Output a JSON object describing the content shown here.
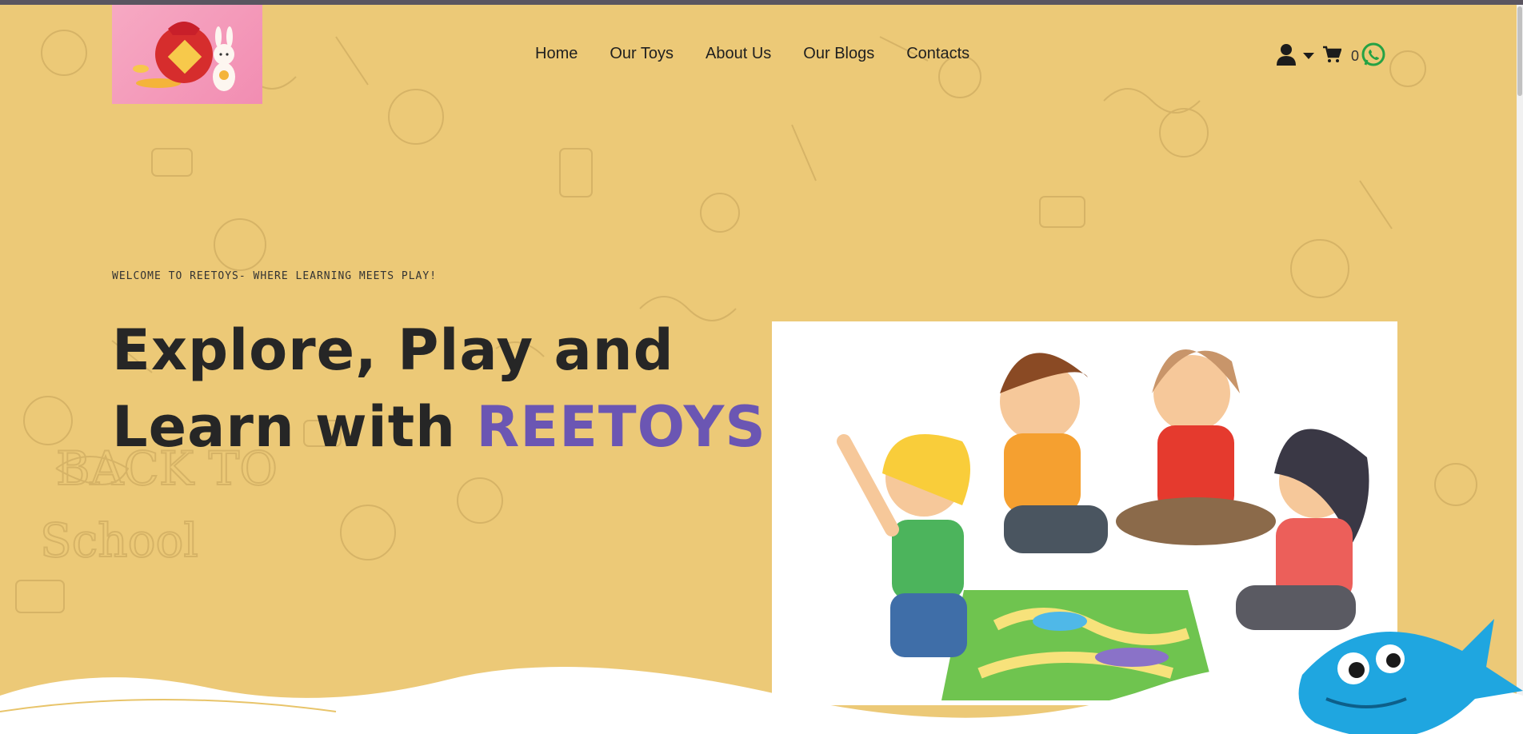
{
  "nav": {
    "items": [
      {
        "label": "Home"
      },
      {
        "label": "Our Toys"
      },
      {
        "label": "About Us"
      },
      {
        "label": "Our Blogs"
      },
      {
        "label": "Contacts"
      }
    ]
  },
  "header_icons": {
    "user_icon": "user-icon",
    "dropdown_icon": "caret-down-icon",
    "cart_icon": "cart-icon",
    "cart_count": "0",
    "whatsapp_icon": "whatsapp-icon"
  },
  "hero": {
    "welcome": "Welcome to Reetoys- Where Learning Meets Play!",
    "headline_line1": "Explore, Play and",
    "headline_line2_prefix": "Learn with ",
    "headline_brand": "REETOYS!!..",
    "brand_color": "#6b56b3"
  },
  "colors": {
    "background": "#ecc977",
    "accent": "#6b56b3",
    "whatsapp": "#25a244"
  }
}
